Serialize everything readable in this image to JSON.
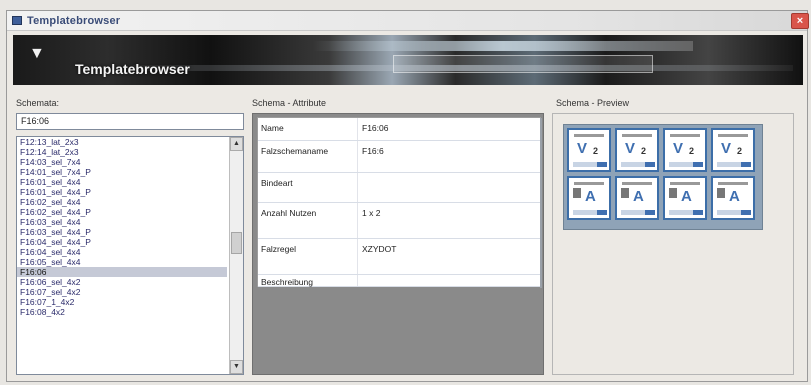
{
  "window": {
    "title": "Templatebrowser",
    "close_glyph": "×"
  },
  "banner": {
    "chevron": "▼",
    "title": "Templatebrowser"
  },
  "left": {
    "label": "Schemata:",
    "filter_value": "F16:06",
    "items": [
      "F12:13_lat_2x3",
      "F12:14_lat_2x3",
      "F14:03_sel_7x4",
      "F14:01_sel_7x4_P",
      "F16:01_sel_4x4",
      "F16:01_sel_4x4_P",
      "F16:02_sel_4x4",
      "F16:02_sel_4x4_P",
      "F16:03_sel_4x4",
      "F16:03_sel_4x4_P",
      "F16:04_sel_4x4_P",
      "F16:04_sel_4x4",
      "F16:05_sel_4x4",
      "F16:06",
      "F16:06_sel_4x2",
      "F16:07_sel_4x2",
      "F16:07_1_4x2",
      "F16:08_4x2"
    ],
    "selected_index": 13,
    "scroll_up": "▲",
    "scroll_down": "▼"
  },
  "attributes": {
    "label": "Schema - Attribute",
    "rows": [
      {
        "key": "Name",
        "value": "F16:06"
      },
      {
        "key": "Falzschemaname",
        "value": "F16:6"
      },
      {
        "key": "Bindeart",
        "value": ""
      },
      {
        "key": "Anzahl Nutzen",
        "value": "1 x 2"
      },
      {
        "key": "Falzregel",
        "value": "XZYDOT"
      },
      {
        "key": "Beschreibung",
        "value": ""
      }
    ]
  },
  "preview": {
    "label": "Schema - Preview",
    "thumbs": [
      {
        "glyph": "V",
        "num": "2"
      },
      {
        "glyph": "V",
        "num": "2"
      },
      {
        "glyph": "V",
        "num": "2"
      },
      {
        "glyph": "V",
        "num": "2"
      },
      {
        "glyph": "A",
        "num": ""
      },
      {
        "glyph": "A",
        "num": ""
      },
      {
        "glyph": "A",
        "num": ""
      },
      {
        "glyph": "A",
        "num": ""
      }
    ]
  }
}
